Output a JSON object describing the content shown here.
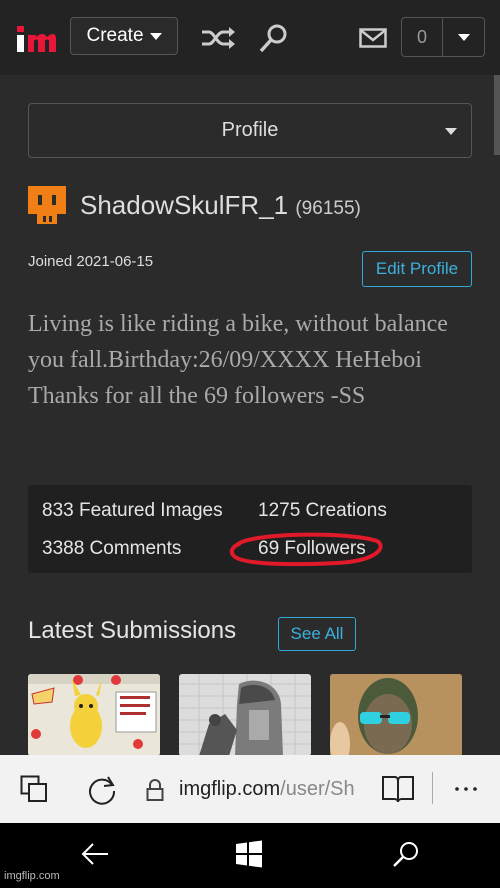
{
  "header": {
    "create_label": "Create",
    "notification_count": "0"
  },
  "profile_select": {
    "label": "Profile"
  },
  "user": {
    "username": "ShadowSkulFR_1",
    "points": "(96155)",
    "joined": "Joined 2021-06-15",
    "edit_label": "Edit Profile",
    "bio": "Living is like riding a bike, without balance you fall.Birthday:26/09/XXXX HeHeboi Thanks for all the 69 followers -SS"
  },
  "stats": {
    "featured": "833 Featured Images",
    "creations": "1275 Creations",
    "comments": "3388 Comments",
    "followers": "69 Followers"
  },
  "latest": {
    "title": "Latest Submissions",
    "see_all": "See All"
  },
  "browser": {
    "url_domain": "imgflip.com",
    "url_path": "/user/Sh"
  },
  "watermark": "imgflip.com",
  "colors": {
    "accent_blue": "#2fa7d8",
    "logo_red": "#e8173a",
    "avatar_orange": "#f07f16",
    "annotation_red": "#e11a2a"
  }
}
